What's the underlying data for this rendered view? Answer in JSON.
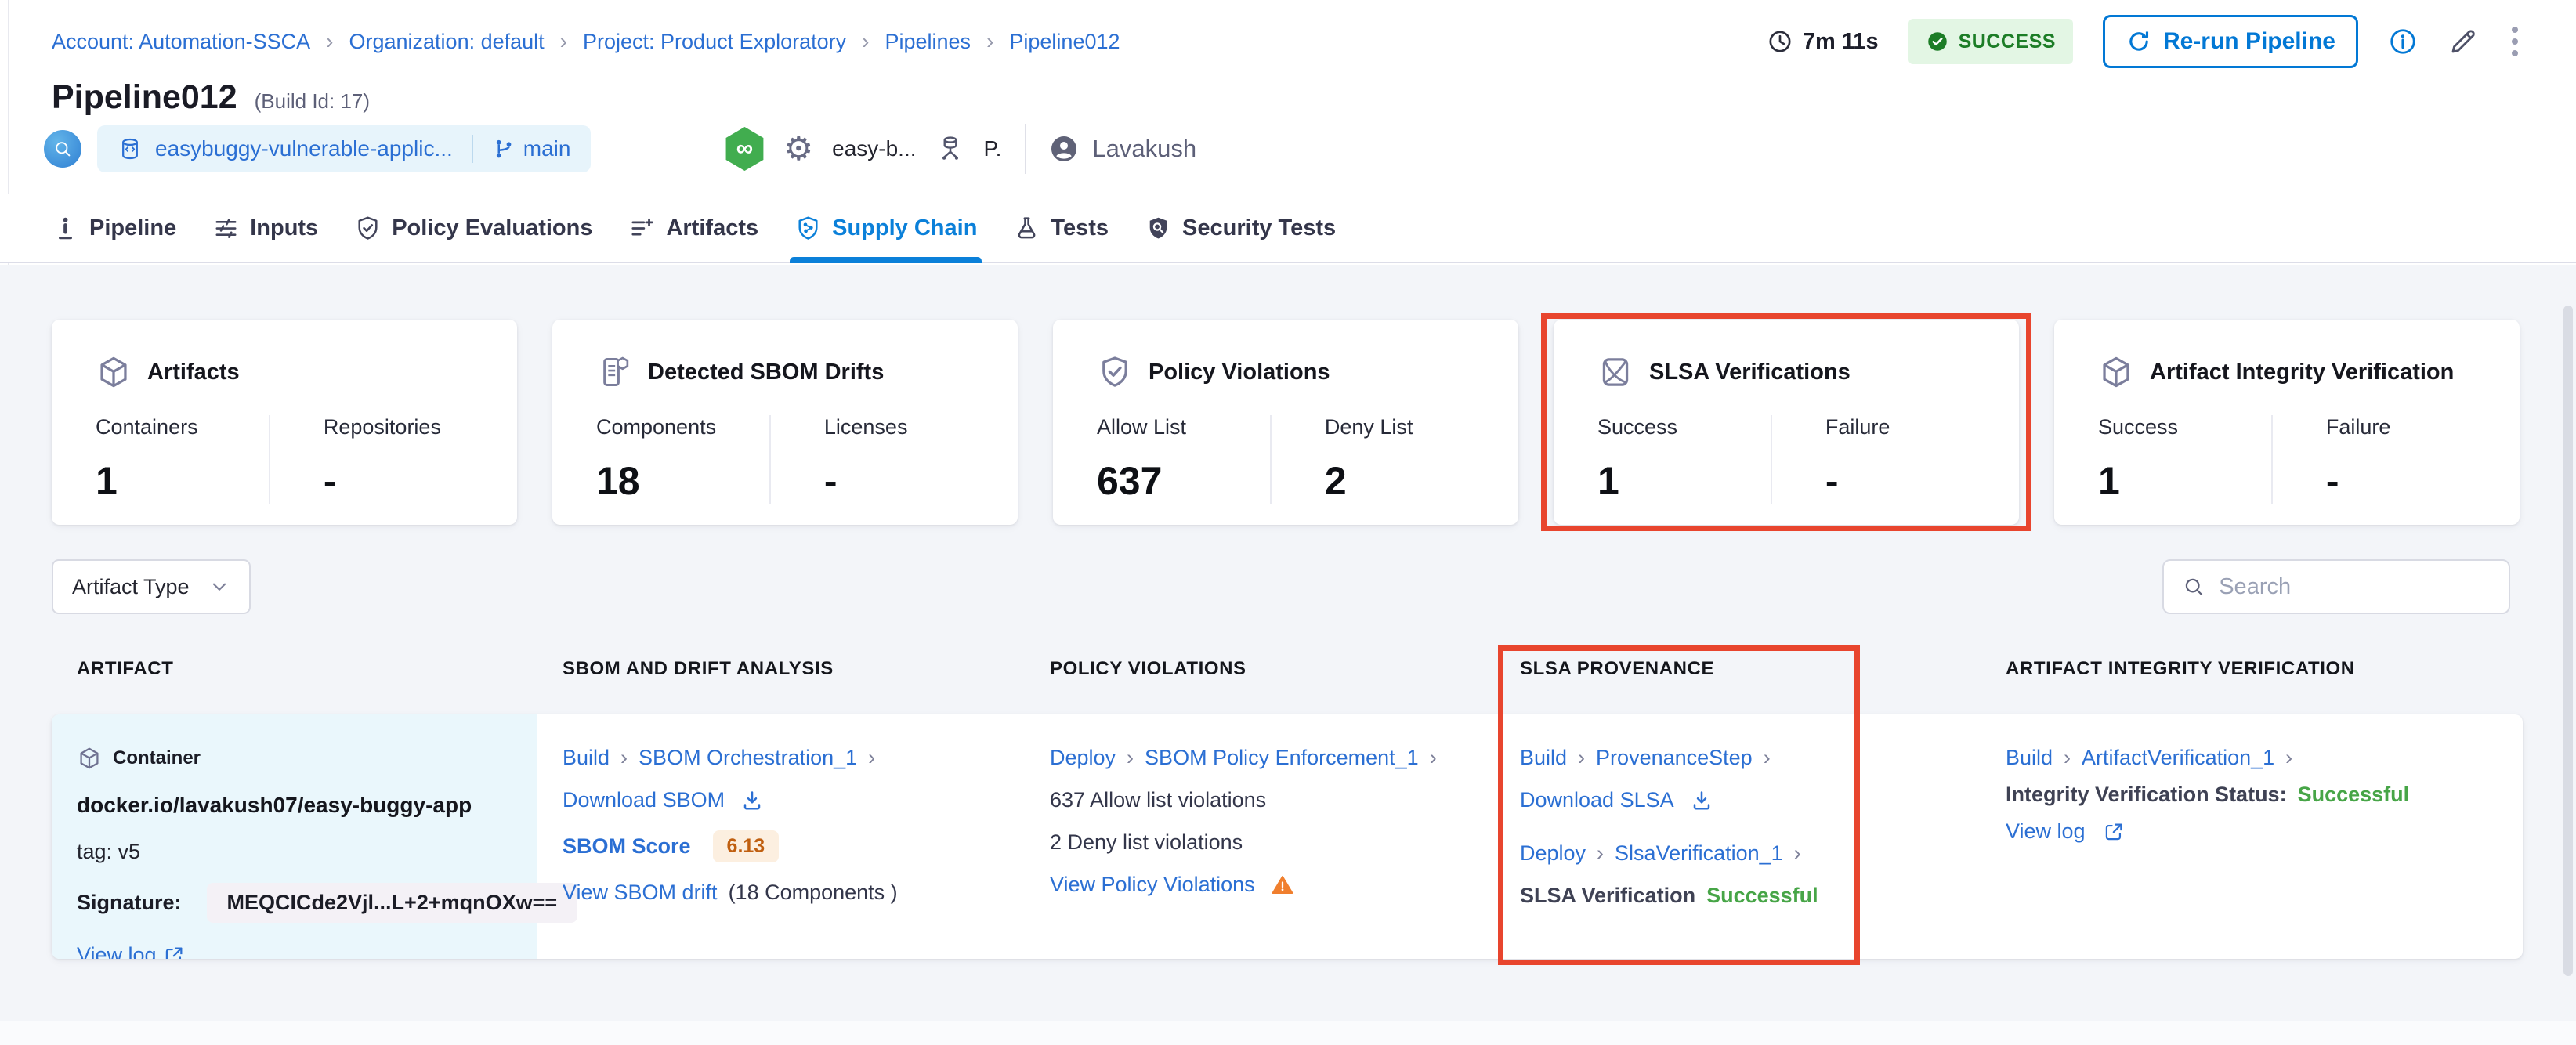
{
  "breadcrumb": {
    "items": [
      "Account: Automation-SSCA",
      "Organization: default",
      "Project: Product Exploratory",
      "Pipelines",
      "Pipeline012"
    ]
  },
  "header": {
    "duration": "7m 11s",
    "status": "SUCCESS",
    "rerun_label": "Re-run Pipeline",
    "title": "Pipeline012",
    "build_id": "(Build Id: 17)",
    "repo": "easybuggy-vulnerable-applic...",
    "branch": "main",
    "trigger_pipeline": "easy-b...",
    "trigger_stage": "P.",
    "user": "Lavakush"
  },
  "tabs": [
    {
      "label": "Pipeline",
      "active": false
    },
    {
      "label": "Inputs",
      "active": false
    },
    {
      "label": "Policy Evaluations",
      "active": false
    },
    {
      "label": "Artifacts",
      "active": false
    },
    {
      "label": "Supply Chain",
      "active": true
    },
    {
      "label": "Tests",
      "active": false
    },
    {
      "label": "Security Tests",
      "active": false
    }
  ],
  "cards": [
    {
      "title": "Artifacts",
      "icon": "cube-icon",
      "highlighted": false,
      "stats": [
        {
          "label": "Containers",
          "value": "1"
        },
        {
          "label": "Repositories",
          "value": "-"
        }
      ]
    },
    {
      "title": "Detected SBOM Drifts",
      "icon": "sbom-scroll-icon",
      "highlighted": false,
      "stats": [
        {
          "label": "Components",
          "value": "18"
        },
        {
          "label": "Licenses",
          "value": "-"
        }
      ]
    },
    {
      "title": "Policy Violations",
      "icon": "shield-check-icon",
      "highlighted": false,
      "stats": [
        {
          "label": "Allow List",
          "value": "637"
        },
        {
          "label": "Deny List",
          "value": "2"
        }
      ]
    },
    {
      "title": "SLSA Verifications",
      "icon": "slsa-certificate-icon",
      "highlighted": true,
      "stats": [
        {
          "label": "Success",
          "value": "1"
        },
        {
          "label": "Failure",
          "value": "-"
        }
      ]
    },
    {
      "title": "Artifact Integrity Verification",
      "icon": "cube-icon",
      "highlighted": false,
      "stats": [
        {
          "label": "Success",
          "value": "1"
        },
        {
          "label": "Failure",
          "value": "-"
        }
      ]
    }
  ],
  "filters": {
    "artifact_type_label": "Artifact Type",
    "search_placeholder": "Search"
  },
  "table": {
    "headers": [
      "ARTIFACT",
      "SBOM AND DRIFT ANALYSIS",
      "POLICY VIOLATIONS",
      "SLSA PROVENANCE",
      "ARTIFACT INTEGRITY VERIFICATION"
    ],
    "row": {
      "artifact": {
        "type_label": "Container",
        "image": "docker.io/lavakush07/easy-buggy-app",
        "tag": "tag: v5",
        "signature_label": "Signature:",
        "signature_value": "MEQCICde2Vjl...L+2+mqnOXw==",
        "view_log_label": "View log"
      },
      "sbom": {
        "stage": "Build",
        "step": "SBOM Orchestration_1",
        "download_label": "Download SBOM",
        "score_label": "SBOM Score",
        "score_value": "6.13",
        "drift_link": "View SBOM drift",
        "drift_suffix": "(18 Components )"
      },
      "policy": {
        "stage": "Deploy",
        "step": "SBOM Policy Enforcement_1",
        "allow_text": "637 Allow list violations",
        "deny_text": "2 Deny list violations",
        "view_link": "View Policy Violations"
      },
      "slsa": {
        "build_stage": "Build",
        "build_step": "ProvenanceStep",
        "download_label": "Download SLSA",
        "deploy_stage": "Deploy",
        "deploy_step": "SlsaVerification_1",
        "status_label": "SLSA Verification",
        "status_value": "Successful"
      },
      "integrity": {
        "stage": "Build",
        "step": "ArtifactVerification_1",
        "status_label": "Integrity Verification Status:",
        "status_value": "Successful",
        "view_log_label": "View log"
      }
    }
  },
  "icons": {
    "breadcrumb_separator": "›",
    "chevron_right": "›",
    "gear": "⚙",
    "infinity": "∞"
  },
  "colors": {
    "accent_blue": "#0278d5",
    "link_blue": "#2b6fd3",
    "success_green": "#47a547",
    "success_badge_bg": "#e3f6e4",
    "success_badge_text": "#1c7d26",
    "warning_orange": "#f07f2e",
    "score_orange": "#c05f10",
    "annotation_red": "#e8452e",
    "content_bg": "#f3f5f9",
    "artifact_cell_bg": "#eaf7fc"
  }
}
